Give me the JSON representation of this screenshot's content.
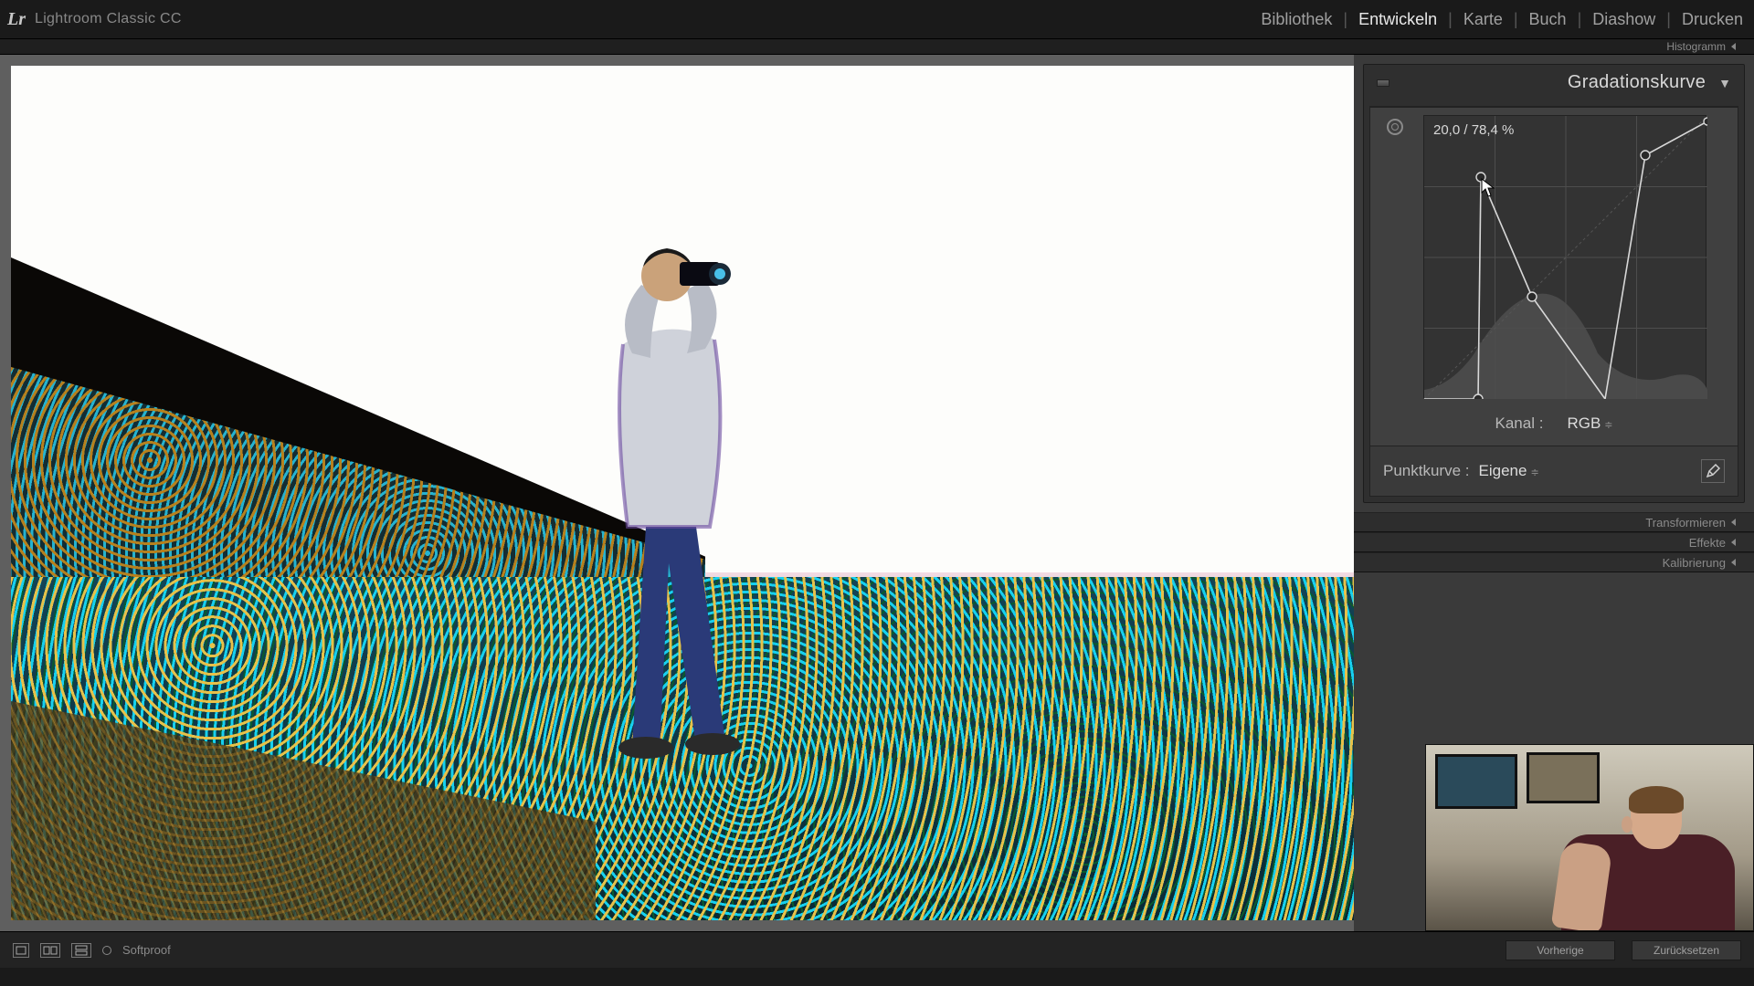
{
  "app": {
    "logo": "Lr",
    "title": "Lightroom Classic CC"
  },
  "nav": {
    "items": [
      "Bibliothek",
      "Entwickeln",
      "Karte",
      "Buch",
      "Diashow",
      "Drucken"
    ],
    "active": "Entwickeln"
  },
  "side_strips": {
    "histogram": "Histogramm"
  },
  "tone_curve_panel": {
    "title": "Gradationskurve",
    "readout": "20,0 / 78,4 %",
    "kanal_label": "Kanal :",
    "kanal_value": "RGB",
    "punktkurve_label": "Punktkurve :",
    "punktkurve_value": "Eigene",
    "curve_points": [
      {
        "x": 0.0,
        "y": 0.0
      },
      {
        "x": 0.19,
        "y": 0.0
      },
      {
        "x": 0.2,
        "y": 0.784
      },
      {
        "x": 0.38,
        "y": 0.36
      },
      {
        "x": 0.64,
        "y": 0.0
      },
      {
        "x": 0.78,
        "y": 0.86
      },
      {
        "x": 1.0,
        "y": 0.98
      }
    ]
  },
  "collapsed_panels": {
    "transform": "Transformieren",
    "effects": "Effekte",
    "calibration": "Kalibrierung"
  },
  "bottom": {
    "softproof": "Softproof",
    "prev": "Vorherige",
    "reset": "Zurücksetzen"
  },
  "colors": {
    "panel_bg": "#3a3a3a",
    "text": "#c8c8c8",
    "accent": "#d8d8d8"
  }
}
